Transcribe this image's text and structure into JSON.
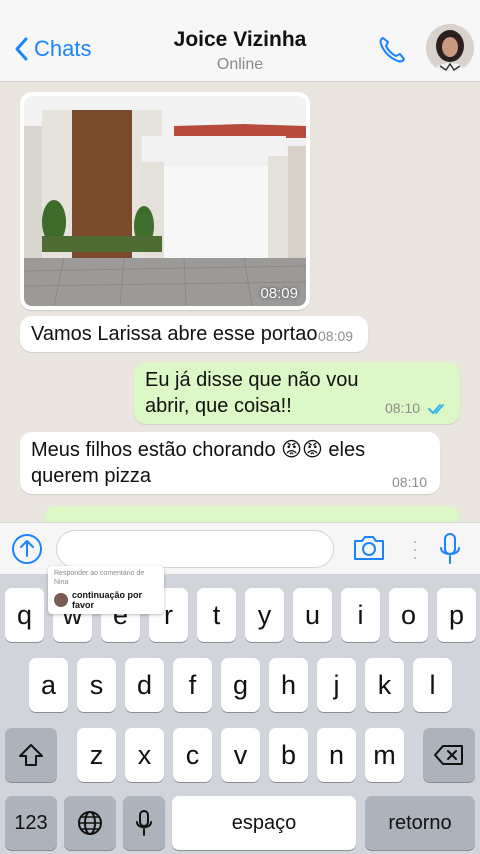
{
  "header": {
    "back_label": "Chats",
    "contact_name": "Joice Vizinha",
    "status": "Online"
  },
  "messages": [
    {
      "type": "photo",
      "direction": "incoming",
      "time": "08:09"
    },
    {
      "type": "text",
      "direction": "incoming",
      "text": "Vamos Larissa abre esse portao",
      "time": "08:09"
    },
    {
      "type": "text",
      "direction": "outgoing",
      "text": "Eu já disse que não vou abrir, que coisa!!",
      "time": "08:10",
      "status": "read"
    },
    {
      "type": "text",
      "direction": "incoming",
      "text": "Meus filhos estão chorando 😡😡 eles querem pizza",
      "time": "08:10"
    },
    {
      "type": "text",
      "direction": "outgoing",
      "text": "",
      "time": ""
    }
  ],
  "input": {
    "value": "",
    "placeholder": ""
  },
  "reply_card": {
    "header": "Responder ao comentário de Nina",
    "text": "continuação por favor"
  },
  "keyboard": {
    "row1": [
      "q",
      "w",
      "e",
      "r",
      "t",
      "y",
      "u",
      "i",
      "o",
      "p"
    ],
    "row2": [
      "a",
      "s",
      "d",
      "f",
      "g",
      "h",
      "j",
      "k",
      "l"
    ],
    "row3": [
      "z",
      "x",
      "c",
      "v",
      "b",
      "n",
      "m"
    ],
    "numbers_label": "123",
    "space_label": "espaço",
    "return_label": "retorno"
  },
  "colors": {
    "accent": "#1a84ff",
    "incoming_bubble": "#ffffff",
    "outgoing_bubble": "#dcf8c6",
    "chat_background": "#eae6df",
    "keyboard_background": "#d1d5db",
    "read_ticks": "#34b7f1"
  },
  "icons": [
    "chevron-left-icon",
    "phone-icon",
    "avatar",
    "plus-circle-icon",
    "camera-icon",
    "microphone-icon",
    "shift-icon",
    "backspace-icon",
    "globe-icon",
    "dictation-mic-icon"
  ]
}
